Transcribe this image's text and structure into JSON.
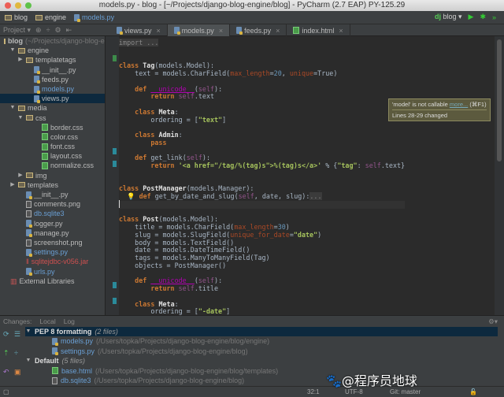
{
  "window": {
    "title": "models.py - blog - [~/Projects/django-blog-engine/blog] - PyCharm (2.7 EAP) PY-125.29"
  },
  "breadcrumbs": [
    "blog",
    "engine",
    "models.py"
  ],
  "run": {
    "config": "blog ▾"
  },
  "project_bar": {
    "label": "Project ▾"
  },
  "tabs": [
    {
      "label": "views.py",
      "active": false
    },
    {
      "label": "models.py",
      "active": true
    },
    {
      "label": "feeds.py",
      "active": false
    },
    {
      "label": "index.html",
      "active": false
    }
  ],
  "tree": [
    {
      "label": "blog",
      "suffix": " (~/Projects/django-blog-engine/blog)",
      "depth": 0,
      "icon": "folder",
      "arrow": "",
      "bold": true
    },
    {
      "label": "engine",
      "depth": 1,
      "icon": "folder",
      "arrow": "▼"
    },
    {
      "label": "templatetags",
      "depth": 2,
      "icon": "folder",
      "arrow": "▶"
    },
    {
      "label": "__init__.py",
      "depth": 3,
      "icon": "py"
    },
    {
      "label": "feeds.py",
      "depth": 3,
      "icon": "py"
    },
    {
      "label": "models.py",
      "depth": 3,
      "icon": "py",
      "color": "#6a9fd4"
    },
    {
      "label": "views.py",
      "depth": 3,
      "icon": "py",
      "selected": true
    },
    {
      "label": "media",
      "depth": 1,
      "icon": "folder",
      "arrow": "▼"
    },
    {
      "label": "css",
      "depth": 2,
      "icon": "folder",
      "arrow": "▼"
    },
    {
      "label": "border.css",
      "depth": 4,
      "icon": "css"
    },
    {
      "label": "color.css",
      "depth": 4,
      "icon": "css"
    },
    {
      "label": "font.css",
      "depth": 4,
      "icon": "css"
    },
    {
      "label": "layout.css",
      "depth": 4,
      "icon": "css"
    },
    {
      "label": "normalize.css",
      "depth": 4,
      "icon": "css"
    },
    {
      "label": "img",
      "depth": 2,
      "icon": "folder",
      "arrow": "▶"
    },
    {
      "label": "templates",
      "depth": 1,
      "icon": "folder",
      "arrow": "▶"
    },
    {
      "label": "__init__.py",
      "depth": 2,
      "icon": "py"
    },
    {
      "label": "comments.png",
      "depth": 2,
      "icon": "txt"
    },
    {
      "label": "db.sqlite3",
      "depth": 2,
      "icon": "txt",
      "color": "#6a9fd4"
    },
    {
      "label": "logger.py",
      "depth": 2,
      "icon": "py"
    },
    {
      "label": "manage.py",
      "depth": 2,
      "icon": "py"
    },
    {
      "label": "screenshot.png",
      "depth": 2,
      "icon": "txt"
    },
    {
      "label": "settings.py",
      "depth": 2,
      "icon": "py",
      "color": "#6a9fd4"
    },
    {
      "label": "sqlitejdbc-v056.jar",
      "depth": 2,
      "icon": "jar",
      "color": "#d05050"
    },
    {
      "label": "urls.py",
      "depth": 2,
      "icon": "py",
      "color": "#6a9fd4"
    },
    {
      "label": "External Libraries",
      "depth": 0,
      "icon": "lib"
    }
  ],
  "code": [
    [
      [
        "import ...",
        "fold"
      ]
    ],
    [],
    [],
    [
      [
        "class ",
        "kw"
      ],
      [
        "Tag",
        "cls"
      ],
      [
        "(models.Model):",
        ""
      ]
    ],
    [
      [
        "    text = models.CharField(",
        ""
      ],
      [
        "max_length",
        "par"
      ],
      [
        "=",
        ""
      ],
      [
        "20",
        "num"
      ],
      [
        ", ",
        ""
      ],
      [
        "unique",
        "par"
      ],
      [
        "=True)",
        ""
      ]
    ],
    [],
    [
      [
        "    ",
        ""
      ],
      [
        "def ",
        "kw"
      ],
      [
        "__unicode__",
        "mag"
      ],
      [
        "(",
        ""
      ],
      [
        "self",
        "self"
      ],
      [
        "):",
        ""
      ]
    ],
    [
      [
        "        ",
        ""
      ],
      [
        "return ",
        "kw"
      ],
      [
        "self",
        "self"
      ],
      [
        ".text",
        ""
      ]
    ],
    [],
    [
      [
        "    ",
        ""
      ],
      [
        "class ",
        "kw"
      ],
      [
        "Meta",
        "cls"
      ],
      [
        ":",
        ""
      ]
    ],
    [
      [
        "        ordering = [",
        ""
      ],
      [
        "\"text\"",
        "str"
      ],
      [
        "]",
        ""
      ]
    ],
    [],
    [
      [
        "    ",
        ""
      ],
      [
        "class ",
        "kw"
      ],
      [
        "Admin",
        "cls"
      ],
      [
        ":",
        ""
      ]
    ],
    [
      [
        "        ",
        ""
      ],
      [
        "pass",
        "kw"
      ]
    ],
    [],
    [
      [
        "    ",
        ""
      ],
      [
        "def ",
        "kw"
      ],
      [
        "get_link",
        ""
      ],
      [
        "(",
        ""
      ],
      [
        "self",
        "self"
      ],
      [
        "):",
        ""
      ]
    ],
    [
      [
        "        ",
        ""
      ],
      [
        "return ",
        "kw"
      ],
      [
        "'<a href=\"/tag/%(tag)s\">%(tag)s</a>'",
        "str"
      ],
      [
        " % {",
        ""
      ],
      [
        "\"tag\"",
        "str"
      ],
      [
        ": ",
        ""
      ],
      [
        "self",
        "self"
      ],
      [
        ".text}",
        ""
      ]
    ],
    [],
    [],
    [
      [
        "class ",
        "kw"
      ],
      [
        "PostManager",
        "cls"
      ],
      [
        "(models.Manager):",
        ""
      ]
    ],
    [
      [
        "  💡 ",
        ""
      ],
      [
        "def ",
        "kw"
      ],
      [
        "get_by_date_and_slug(",
        ""
      ],
      [
        "self",
        "self"
      ],
      [
        ", date, slug):",
        ""
      ],
      [
        "...",
        "fold"
      ]
    ],
    [
      [
        "",
        ""
      ]
    ],
    [],
    [
      [
        "class ",
        "kw"
      ],
      [
        "Post",
        "cls"
      ],
      [
        "(models.Model):",
        ""
      ]
    ],
    [
      [
        "    title = models.CharField(",
        ""
      ],
      [
        "max_length",
        "par"
      ],
      [
        "=",
        ""
      ],
      [
        "30",
        "num"
      ],
      [
        ")",
        ""
      ]
    ],
    [
      [
        "    slug = models.SlugField(",
        ""
      ],
      [
        "unique_for_date",
        "par"
      ],
      [
        "=",
        ""
      ],
      [
        "\"date\"",
        "str"
      ],
      [
        ")",
        ""
      ]
    ],
    [
      [
        "    body = models.TextField()",
        ""
      ]
    ],
    [
      [
        "    date = models.DateTimeField()",
        ""
      ]
    ],
    [
      [
        "    tags = models.ManyToManyField(Tag)",
        ""
      ]
    ],
    [
      [
        "    objects = PostManager()",
        ""
      ]
    ],
    [],
    [
      [
        "    ",
        ""
      ],
      [
        "def ",
        "kw"
      ],
      [
        "__unicode__",
        "mag"
      ],
      [
        "(",
        ""
      ],
      [
        "self",
        "self"
      ],
      [
        "):",
        ""
      ]
    ],
    [
      [
        "        ",
        ""
      ],
      [
        "return ",
        "kw"
      ],
      [
        "self",
        "self"
      ],
      [
        ".title",
        ""
      ]
    ],
    [],
    [
      [
        "    ",
        ""
      ],
      [
        "class ",
        "kw"
      ],
      [
        "Meta",
        "cls"
      ],
      [
        ":",
        ""
      ]
    ],
    [
      [
        "        ordering = [",
        ""
      ],
      [
        "\"-date\"",
        "str"
      ],
      [
        "]",
        ""
      ]
    ]
  ],
  "tooltip": {
    "message": "'model' is not callable ",
    "link": "more...",
    "shortcut": " (⌘F1)",
    "detail": "Lines 28-29 changed"
  },
  "changes": {
    "tabs": [
      "Changes:",
      "Local",
      "Log"
    ],
    "groups": [
      {
        "name": "PEP 8 formatting",
        "count": "(2 files)",
        "files": [
          {
            "name": "models.py",
            "path": "(/Users/topka/Projects/django-blog-engine/blog/engine)",
            "icon": "py"
          },
          {
            "name": "settings.py",
            "path": "(/Users/topka/Projects/django-blog-engine/blog)",
            "icon": "py"
          }
        ]
      },
      {
        "name": "Default",
        "count": "(5 files)",
        "files": [
          {
            "name": "base.html",
            "path": "(/Users/topka/Projects/django-blog-engine/blog/templates)",
            "icon": "css"
          },
          {
            "name": "db.sqlite3",
            "path": "(/Users/topka/Projects/django-blog-engine/blog)",
            "icon": "txt"
          }
        ]
      }
    ]
  },
  "status": {
    "position": "32:1",
    "encoding": "UTF-8",
    "vcs": "Git: master"
  },
  "watermark": "🐾@程序员地球"
}
